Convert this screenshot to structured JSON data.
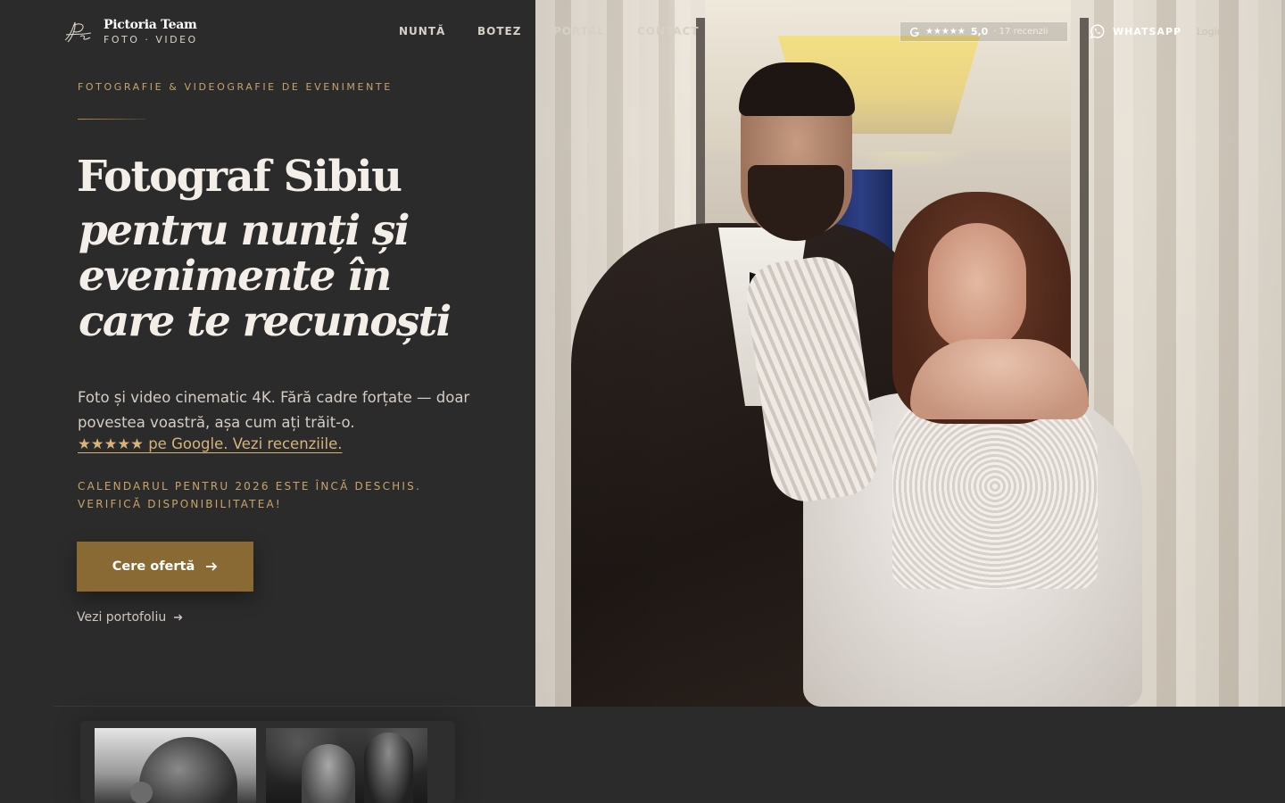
{
  "brand": {
    "name": "Pictoria Team",
    "tagline": "FOTO · VIDEO"
  },
  "nav": {
    "items": [
      "NUNTĂ",
      "BOTEZ",
      "PORTAL",
      "CONTACT"
    ]
  },
  "rating": {
    "icon": "google-icon",
    "stars": "★★★★★",
    "score": "5,0",
    "count": "· 17 recenzii"
  },
  "whatsapp": {
    "icon": "whatsapp-icon",
    "label": "WHATSAPP"
  },
  "login": "Login",
  "hero": {
    "eyebrow": "FOTOGRAFIE & VIDEOGRAFIE DE EVENIMENTE",
    "title": "Fotograf Sibiu",
    "subtitle": "pentru nunți și evenimente în care te recunoști",
    "lead": "Foto și video cinematic 4K. Fără cadre forțate — doar povestea voastră, așa cum ați trăit-o.",
    "reviews_link": "★★★★★ pe Google. Vezi recenziile.",
    "availability": "CALENDARUL PENTRU 2026 ESTE ÎNCĂ DESCHIS. VERIFICĂ DISPONIBILITATEA!",
    "cta_label": "Cere ofertă",
    "cta_icon": "arrow-right-icon",
    "portfolio_label": "Vezi portofoliu",
    "portfolio_icon": "arrow-right-icon"
  },
  "colors": {
    "background": "#2b2b2b",
    "accent_gold": "#c9a368",
    "cta_bg": "#8a6a34",
    "text_light": "#f3efe8"
  }
}
